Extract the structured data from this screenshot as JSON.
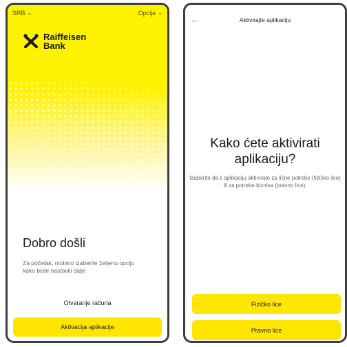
{
  "left_screen": {
    "language": "SRB",
    "options": "Opcije",
    "brand": {
      "line1": "Raiffeisen",
      "line2": "Bank"
    },
    "title": "Dobro došli",
    "description": "Za početak, molimo izaberite željenu opciju kako biste nastavili dalje",
    "open_account_link": "Otvaranje računa",
    "activate_button": "Aktivacija aplikacije"
  },
  "right_screen": {
    "header_title": "Aktivirajte aplikaciju",
    "title": "Kako ćete aktivirati aplikaciju?",
    "description": "Izaberite da li aplikaciju aktivirate za lične potrebe (fizičko lice) ili za potrebe biznisa (pravno lice).",
    "button_individual": "Fizičko lice",
    "button_business": "Pravno lice"
  },
  "colors": {
    "accent_yellow": "#ffe600",
    "back_arrow": "#1bb0c7"
  }
}
